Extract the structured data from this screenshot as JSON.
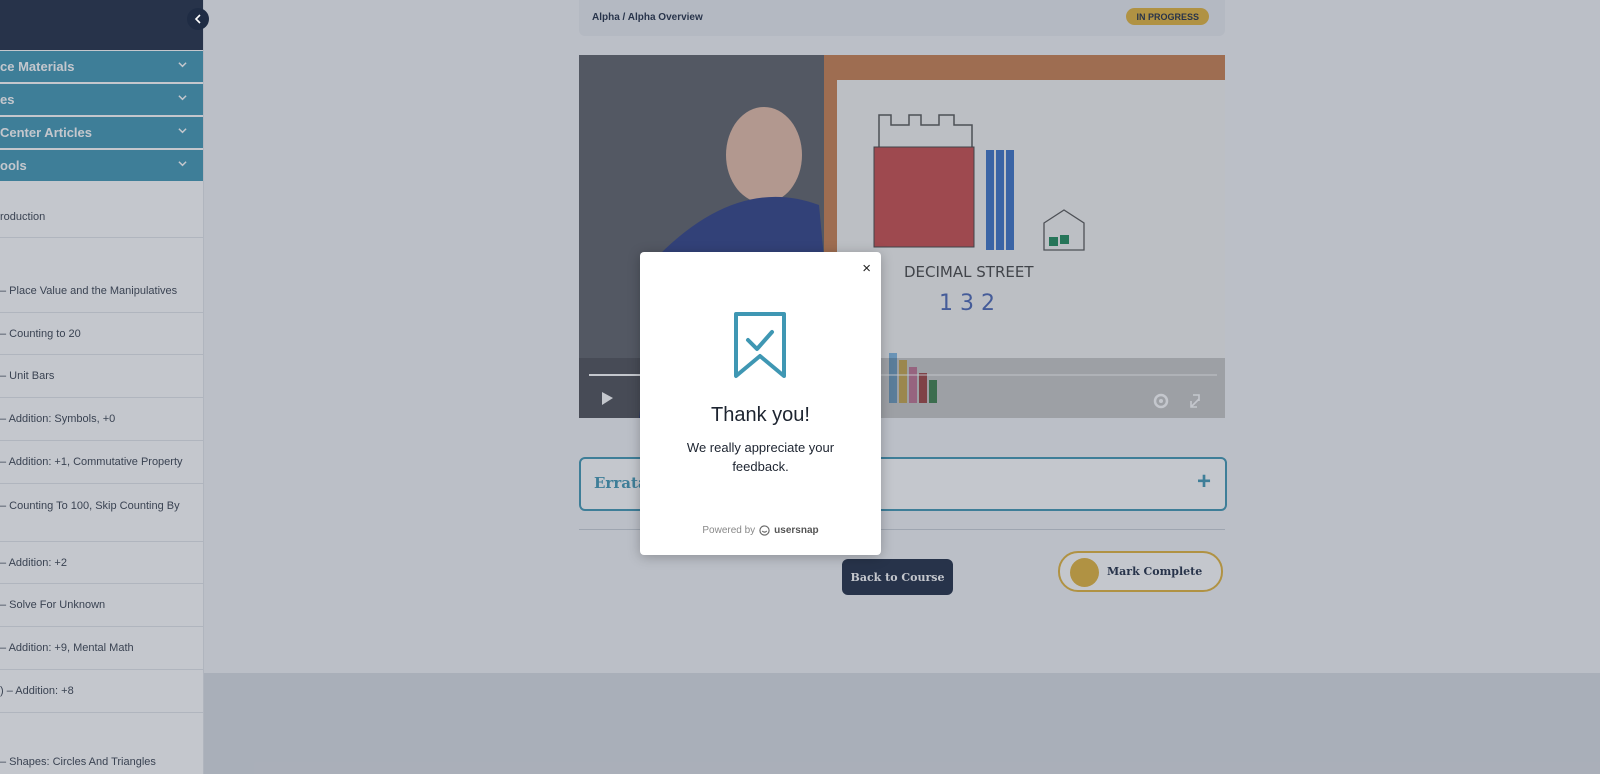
{
  "sidebar": {
    "collapse_icon": "chevron-left-icon",
    "accordions": [
      {
        "label": "ce Materials"
      },
      {
        "label": "es"
      },
      {
        "label": "Center Articles"
      },
      {
        "label": "ools"
      }
    ],
    "lessons": [
      {
        "label": "roduction"
      },
      {
        "label": "– Place Value and the Manipulatives"
      },
      {
        "label": "– Counting to 20"
      },
      {
        "label": "– Unit Bars"
      },
      {
        "label": "– Addition: Symbols, +0"
      },
      {
        "label": "– Addition: +1, Commutative Property"
      },
      {
        "label": "– Counting To 100, Skip Counting By"
      },
      {
        "label": "– Addition: +2"
      },
      {
        "label": "– Solve For Unknown"
      },
      {
        "label": "– Addition: +9, Mental Math"
      },
      {
        "label": ") – Addition: +8"
      },
      {
        "label": "– Shapes: Circles And Triangles"
      }
    ]
  },
  "header": {
    "breadcrumb": "Alpha / Alpha Overview",
    "status": "IN PROGRESS"
  },
  "video": {
    "board_text": "DECIMAL STREET",
    "digits": "1  3  2"
  },
  "errata": {
    "title": "Errata",
    "expand_icon": "plus-icon"
  },
  "actions": {
    "back": "Back to Course",
    "complete": "Mark Complete"
  },
  "modal": {
    "close": "×",
    "title": "Thank you!",
    "message": "We really appreciate your feedback.",
    "powered_by": "Powered by",
    "brand": "usersnap"
  },
  "colors": {
    "navy": "#1f2c44",
    "teal": "#3f97b3",
    "gold": "#e3b33a"
  }
}
